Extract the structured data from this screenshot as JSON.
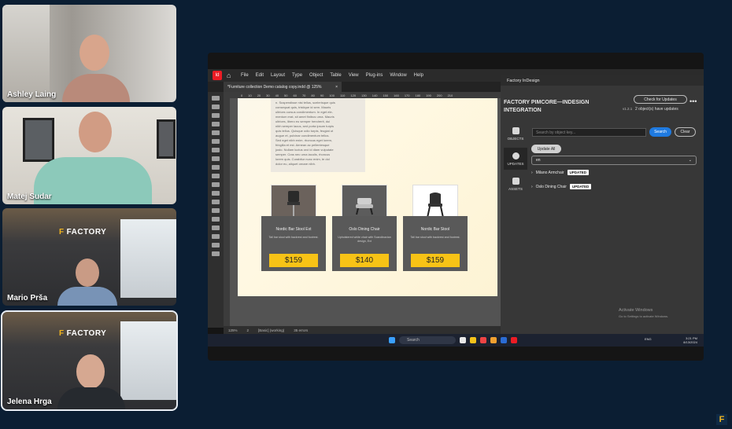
{
  "participants": [
    {
      "name": "Ashley Laing"
    },
    {
      "name": "Matej Sudar"
    },
    {
      "name": "Mario Prša"
    },
    {
      "name": "Jelena Hrga"
    }
  ],
  "backdrop_logo": "FACTORY",
  "app": {
    "menu": [
      "File",
      "Edit",
      "Layout",
      "Type",
      "Object",
      "Table",
      "View",
      "Plug-ins",
      "Window",
      "Help"
    ],
    "doc_tab": "*Furniture collection Demo catalog copy.indd @ 125%",
    "ruler_ticks": [
      "0",
      "10",
      "20",
      "30",
      "40",
      "50",
      "60",
      "70",
      "80",
      "90",
      "100",
      "110",
      "120",
      "130",
      "140",
      "150",
      "160",
      "170",
      "180",
      "190",
      "200",
      "210"
    ],
    "text_frame_lines": [
      "n. Suspendisse nisi tellus, scelerisque quis",
      "consequat quis, tristique id sem. Mauris",
      "ultrices cursus condimentum. In eget ele-",
      "mentum erat, sit amet finibus urna. Mauris",
      "ultrices, libero eu semper hendrerit, dui",
      "nibh semper lacus, sed porta ipsum turpis",
      "quis tellus. Quisque odio turpis, feugiat ut",
      "augue et, pulvinar condimentum tellus.",
      "Sed eget nibh enim. rhoncus eget lorem,",
      "fringilla et est. Aenean ac pellentesque",
      "justo. Nullam luctus orci id diam vulputate",
      "semper. Cras nec urna iaculis, rhoncus",
      "lorem quis. Curabitur nunc enim, te dol",
      "dolor eu, aliquet ornare nibh."
    ],
    "products": [
      {
        "title": "Nordic Bar Stool Ext",
        "desc": "Tall bar stool with backrest and footrest.",
        "price": "$159"
      },
      {
        "title": "Oslo Dining Chair",
        "desc": "Upholstered white chair with Scandinavian design, Ext",
        "price": "$140"
      },
      {
        "title": "Nordic Bar Stool",
        "desc": "Tall bar stool with backrest and footrest.",
        "price": "$159"
      }
    ],
    "statusbar": {
      "zoom": "125%",
      "page": "2",
      "style": "[Basic] (working)",
      "errors": "35 errors"
    },
    "taskbar": {
      "search": "Search",
      "time": "3:21 PM",
      "date": "8/13/2024",
      "lang": "ENG"
    }
  },
  "plugin": {
    "header": "Factory InDesign",
    "title_line1": "FACTORY PIMCORE—INDESIGN",
    "title_line2": "INTEGRATION",
    "version": "v1.2.1",
    "check_updates": "Check for Updates",
    "update_count": "2 object(s) have updates",
    "nav": [
      {
        "label": "OBJECTS",
        "icon": "objects-icon"
      },
      {
        "label": "UPDATES",
        "icon": "updates-icon"
      },
      {
        "label": "ASSETS",
        "icon": "assets-icon"
      }
    ],
    "search_placeholder": "Search by object key...",
    "search_btn": "Search",
    "clear_btn": "Clear",
    "update_all": "Update All",
    "language": "en",
    "items": [
      {
        "name": "Milano Armchair",
        "status": "UPDATED"
      },
      {
        "name": "Oslo Dining Chair",
        "status": "UPDATED"
      }
    ],
    "activate_title": "Activate Windows",
    "activate_sub": "Go to Settings to activate Windows."
  }
}
